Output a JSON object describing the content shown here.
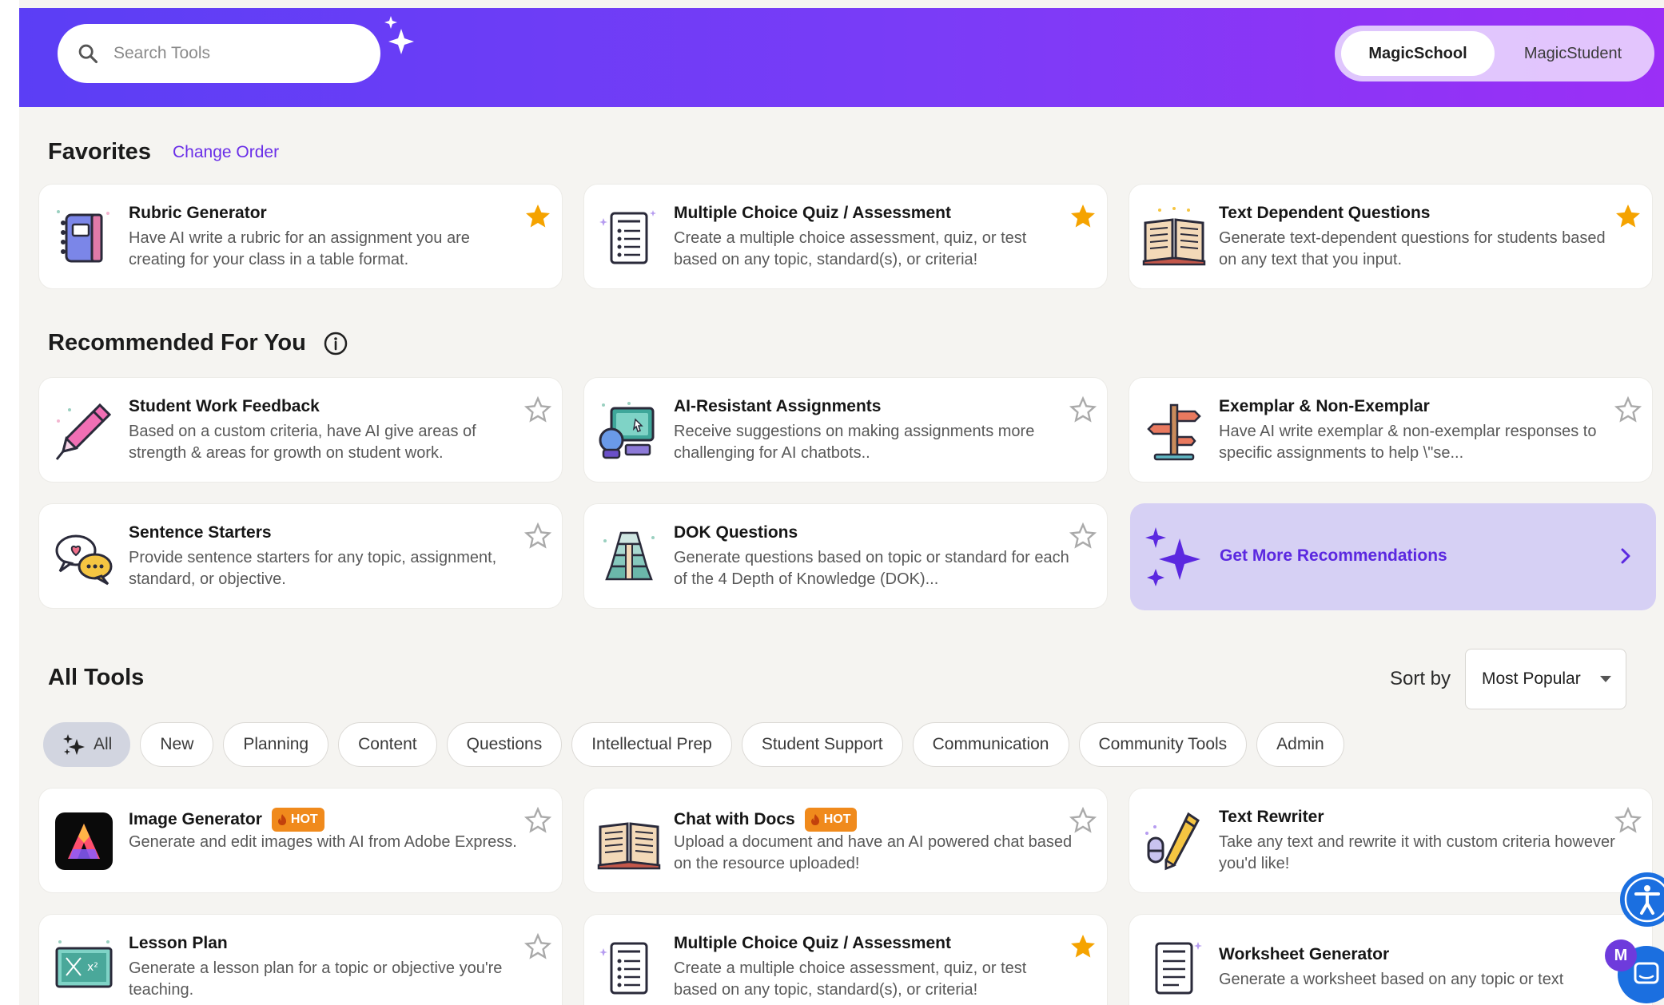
{
  "header": {
    "search_placeholder": "Search Tools",
    "toggle_active": "MagicSchool",
    "toggle_inactive": "MagicStudent"
  },
  "favorites": {
    "title": "Favorites",
    "change_order": "Change Order",
    "items": [
      {
        "title": "Rubric Generator",
        "desc": "Have AI write a rubric for an assignment you are creating for your class in a table format.",
        "favorited": true,
        "icon": "notebook-icon"
      },
      {
        "title": "Multiple Choice Quiz / Assessment",
        "desc": "Create a multiple choice assessment, quiz, or test based on any topic, standard(s), or criteria!",
        "favorited": true,
        "icon": "quiz-sheet-icon"
      },
      {
        "title": "Text Dependent Questions",
        "desc": "Generate text-dependent questions for students based on any text that you input.",
        "favorited": true,
        "icon": "open-book-icon"
      }
    ]
  },
  "recommended": {
    "title": "Recommended For You",
    "items": [
      {
        "title": "Student Work Feedback",
        "desc": "Based on a custom criteria, have AI give areas of strength & areas for growth on student work.",
        "favorited": false,
        "icon": "pen-icon"
      },
      {
        "title": "AI-Resistant Assignments",
        "desc": "Receive suggestions on making assignments more challenging for AI chatbots..",
        "favorited": false,
        "icon": "computer-icon"
      },
      {
        "title": "Exemplar & Non-Exemplar",
        "desc": "Have AI write exemplar & non-exemplar responses to specific assignments to help \\\"se...",
        "favorited": false,
        "icon": "signpost-icon"
      },
      {
        "title": "Sentence Starters",
        "desc": "Provide sentence starters for any topic, assignment, standard, or objective.",
        "favorited": false,
        "icon": "speech-bubbles-icon"
      },
      {
        "title": "DOK Questions",
        "desc": "Generate questions based on topic or standard for each of the 4 Depth of Knowledge (DOK)...",
        "favorited": false,
        "icon": "pyramid-icon"
      }
    ],
    "more_label": "Get More Recommendations"
  },
  "all_tools": {
    "title": "All Tools",
    "sort_label": "Sort by",
    "sort_value": "Most Popular",
    "chips": [
      "All",
      "New",
      "Planning",
      "Content",
      "Questions",
      "Intellectual Prep",
      "Student Support",
      "Communication",
      "Community Tools",
      "Admin"
    ],
    "hot_label": "HOT",
    "items": [
      {
        "title": "Image Generator",
        "desc": "Generate and edit images with AI from Adobe Express.",
        "hot": true,
        "favorited": false,
        "icon": "adobe-express-icon"
      },
      {
        "title": "Chat with Docs",
        "desc": "Upload a document and have an AI powered chat based on the resource uploaded!",
        "hot": true,
        "favorited": false,
        "icon": "open-book-icon"
      },
      {
        "title": "Text Rewriter",
        "desc": "Take any text and rewrite it with custom criteria however you'd like!",
        "hot": false,
        "favorited": false,
        "icon": "pencil-eraser-icon"
      },
      {
        "title": "Lesson Plan",
        "desc": "Generate a lesson plan for a topic or objective you're teaching.",
        "hot": false,
        "favorited": false,
        "icon": "chalkboard-icon"
      },
      {
        "title": "Multiple Choice Quiz / Assessment",
        "desc": "Create a multiple choice assessment, quiz, or test based on any topic, standard(s), or criteria!",
        "hot": false,
        "favorited": true,
        "icon": "quiz-sheet-icon"
      },
      {
        "title": "Worksheet Generator",
        "desc": "Generate a worksheet based on any topic or text",
        "hot": false,
        "favorited": false,
        "icon": "quiz-sheet-icon"
      }
    ]
  },
  "floating": {
    "avatar_letter": "M"
  },
  "colors": {
    "brand_purple": "#7a3cf7",
    "star_gold": "#f5a300",
    "hot_orange": "#f08a1c",
    "accessibility_blue": "#1b6fe0"
  }
}
